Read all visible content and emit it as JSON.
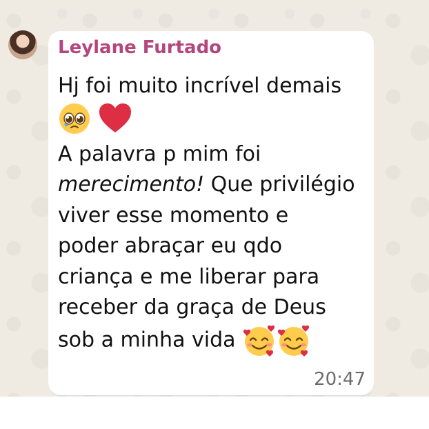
{
  "chat": {
    "sender_name": "Leylane Furtado",
    "message_lines": {
      "l1": "Hj foi muito incrível demais",
      "l3": "A palavra p mim foi",
      "l4_italic": "merecimento!",
      "l4_rest": " Que privilégio",
      "l5": "viver esse momento e",
      "l6": "poder abraçar eu qdo",
      "l7": "criança e me liberar para",
      "l8": "receber da graça de Deus",
      "l9": "sob a minha vida "
    },
    "emojis": [
      "pleading-face",
      "red-heart",
      "smiling-face-with-hearts",
      "smiling-face-with-hearts"
    ],
    "timestamp": "20:47"
  }
}
